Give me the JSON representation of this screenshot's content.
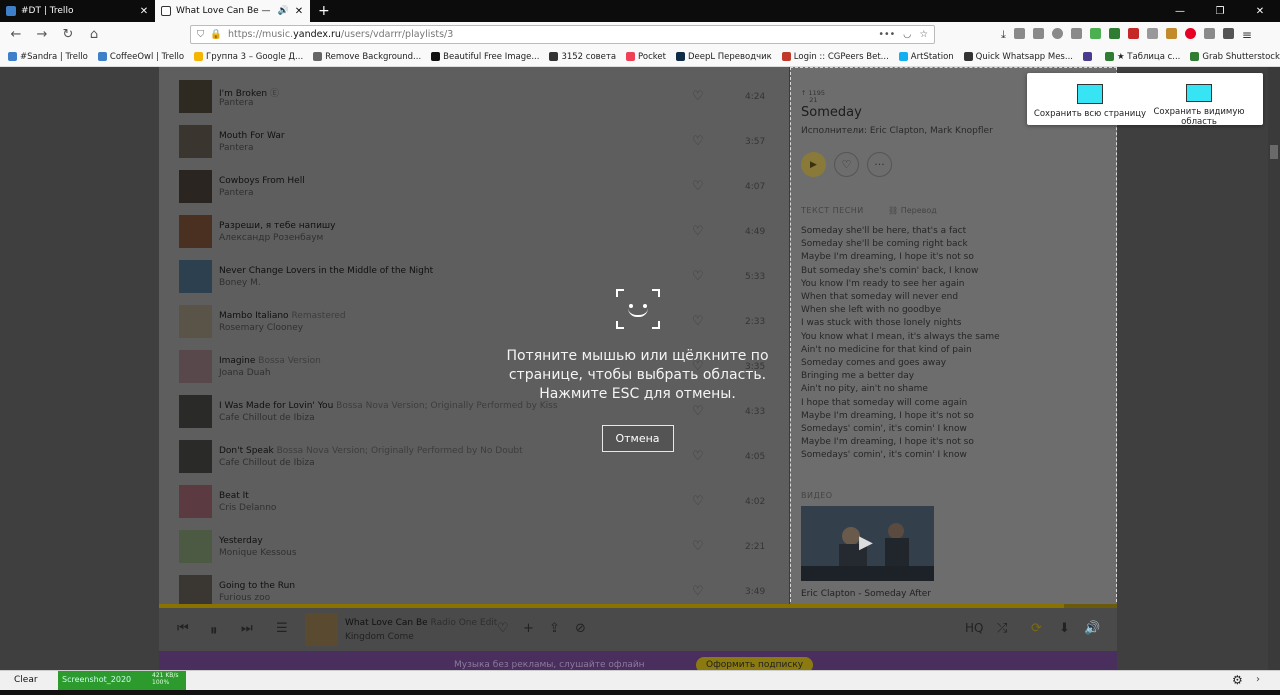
{
  "tabs": [
    {
      "title": "#DT | Trello",
      "favicon_color": "#3d7fc8",
      "close": "✕"
    },
    {
      "title": "What Love Can Be — Kingd",
      "favicon_color": "#ffffff",
      "close": "✕",
      "audio_icon": "speaker-icon"
    }
  ],
  "new_tab": "+",
  "window_controls": [
    "—",
    "❐",
    "✕"
  ],
  "url_bar": {
    "scheme_prefix": "https://music.",
    "host": "yandex.ru",
    "path": "/users/vdarrr/playlists/3"
  },
  "bookmarks": [
    {
      "label": "#Sandra | Trello",
      "color": "#3d7fc8"
    },
    {
      "label": "CoffeeOwl | Trello",
      "color": "#3d7fc8"
    },
    {
      "label": "Группа 3 – Google Д...",
      "color": "#f4b400"
    },
    {
      "label": "Remove Background...",
      "color": "#666666"
    },
    {
      "label": "Beautiful Free Image...",
      "color": "#111111"
    },
    {
      "label": "3152 совета",
      "color": "#333333"
    },
    {
      "label": "Pocket",
      "color": "#ef4056"
    },
    {
      "label": "DeepL Переводчик",
      "color": "#0f2b46"
    },
    {
      "label": "Login :: CGPeers Bet...",
      "color": "#c0392b"
    },
    {
      "label": "ArtStation",
      "color": "#13aff0"
    },
    {
      "label": "Quick Whatsapp Mes...",
      "color": "#333333"
    },
    {
      "label": "",
      "color": "#4a3b8c"
    },
    {
      "label": "★ Таблица с...",
      "color": "#2e7d32"
    },
    {
      "label": "Grab Shutterstock Ph...",
      "color": "#2e7d32"
    }
  ],
  "tracks": [
    {
      "name": "I'm Broken",
      "version": "Ⓔ",
      "artist": "Pantera",
      "duration": "4:24",
      "cover": "#2e2a22"
    },
    {
      "name": "Mouth For War",
      "version": "",
      "artist": "Pantera",
      "duration": "3:57",
      "cover": "#3b3530"
    },
    {
      "name": "Cowboys From Hell",
      "version": "",
      "artist": "Pantera",
      "duration": "4:07",
      "cover": "#2a2520"
    },
    {
      "name": "Разреши, я тебе напишу",
      "version": "",
      "artist": "Александр Розенбаум",
      "duration": "4:49",
      "cover": "#4a3020"
    },
    {
      "name": "Never Change Lovers in the Middle of the Night",
      "version": "",
      "artist": "Boney M.",
      "duration": "5:33",
      "cover": "#2c4050"
    },
    {
      "name": "Mambo Italiano",
      "version": "Remastered",
      "artist": "Rosemary Clooney",
      "duration": "2:33",
      "cover": "#5a5448"
    },
    {
      "name": "Imagine",
      "version": "Bossa Version",
      "artist": "Joana Duah",
      "duration": "3:35",
      "cover": "#58484c"
    },
    {
      "name": "I Was Made for Lovin' You",
      "version": "Bossa Nova Version; Originally Performed by Kiss",
      "artist": "Cafe Chillout de Ibiza",
      "duration": "4:33",
      "cover": "#2a2a28"
    },
    {
      "name": "Don't Speak",
      "version": "Bossa Nova Version; Originally Performed by No Doubt",
      "artist": "Cafe Chillout de Ibiza",
      "duration": "4:05",
      "cover": "#2a2a28"
    },
    {
      "name": "Beat It",
      "version": "",
      "artist": "Cris Delanno",
      "duration": "4:02",
      "cover": "#5c3a42"
    },
    {
      "name": "Yesterday",
      "version": "",
      "artist": "Monique Kessous",
      "duration": "2:21",
      "cover": "#4c5a44"
    },
    {
      "name": "Going to the Run",
      "version": "",
      "artist": "Furious zoo",
      "duration": "3:49",
      "cover": "#3a3632"
    }
  ],
  "song_panel": {
    "count": "↑ 1195\n    21",
    "title": "Someday",
    "performers": "Исполнители: Eric Clapton, Mark Knopfler",
    "lyrics_heading": "ТЕКСТ ПЕСНИ",
    "translation": "Перевод",
    "lyrics": [
      "Someday she'll be here, that's a fact",
      "Someday she'll be coming right back",
      "Maybe I'm dreaming, I hope it's not so",
      "But someday she's comin' back, I know",
      "You know I'm ready to see her again",
      "When that someday will never end",
      "When she left with no goodbye",
      "I was stuck with those lonely nights",
      "You know what I mean, it's always the same",
      "Ain't no medicine for that kind of pain",
      "Someday comes and goes away",
      "Bringing me a better day",
      "Ain't no pity, ain't no shame",
      "I hope that someday will come again",
      "Maybe I'm dreaming, I hope it's not so",
      "Somedays' comin', it's comin' I know",
      "Maybe I'm dreaming, I hope it's not so",
      "Somedays' comin', it's comin' I know"
    ],
    "video_heading": "ВИДЕО",
    "video_title": "Eric Clapton - Someday After"
  },
  "player": {
    "track": "What Love Can Be",
    "version": "Radio One Edit",
    "artist": "Kingdom Come",
    "quality": "HQ",
    "progress": 0.945
  },
  "ad": {
    "text": "Музыка без рекламы, слушайте офлайн",
    "button": "Оформить подписку"
  },
  "overlay": {
    "instruction": "Потяните мышью или щёлкните по странице, чтобы выбрать область. Нажмите ESC для отмены.",
    "cancel": "Отмена"
  },
  "save_panel": {
    "full_page": "Сохранить всю страницу",
    "visible_area": "Сохранить видимую область"
  },
  "statusbar": {
    "clear": "Clear",
    "download_name": "Screenshot_2020",
    "download_info": "421 KB/s\n100%"
  }
}
